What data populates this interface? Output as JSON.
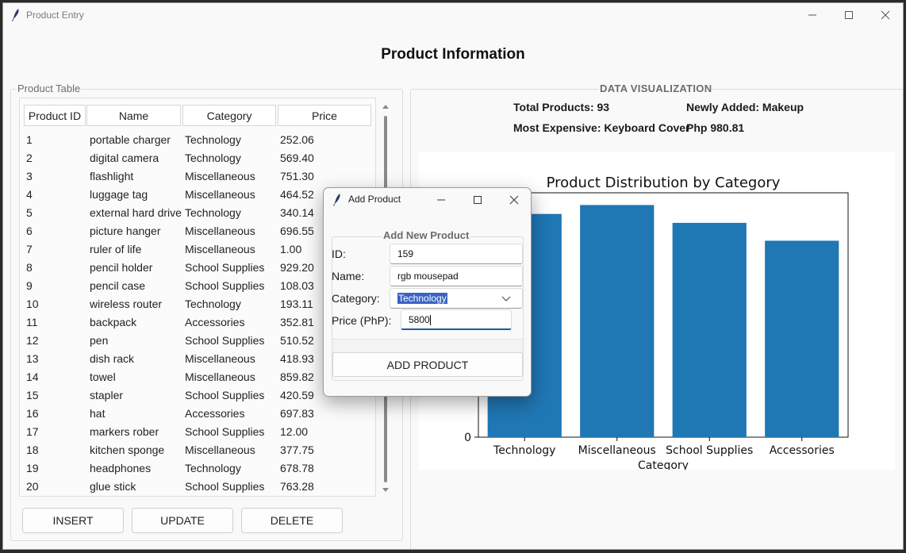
{
  "window": {
    "title": "Product Entry"
  },
  "heading": "Product Information",
  "table_frame_label": "Product Table",
  "columns": [
    "Product ID",
    "Name",
    "Category",
    "Price"
  ],
  "rows": [
    [
      "1",
      "portable charger",
      "Technology",
      "252.06"
    ],
    [
      "2",
      "digital camera",
      "Technology",
      "569.40"
    ],
    [
      "3",
      "flashlight",
      "Miscellaneous",
      "751.30"
    ],
    [
      "4",
      "luggage tag",
      "Miscellaneous",
      "464.52"
    ],
    [
      "5",
      "external hard drive",
      "Technology",
      "340.14"
    ],
    [
      "6",
      "picture hanger",
      "Miscellaneous",
      "696.55"
    ],
    [
      "7",
      "ruler of life",
      "Miscellaneous",
      "1.00"
    ],
    [
      "8",
      "pencil holder",
      "School Supplies",
      "929.20"
    ],
    [
      "9",
      "pencil case",
      "School Supplies",
      "108.03"
    ],
    [
      "10",
      "wireless router",
      "Technology",
      "193.11"
    ],
    [
      "11",
      "backpack",
      "Accessories",
      "352.81"
    ],
    [
      "12",
      "pen",
      "School Supplies",
      "510.52"
    ],
    [
      "13",
      "dish rack",
      "Miscellaneous",
      "418.93"
    ],
    [
      "14",
      "towel",
      "Miscellaneous",
      "859.82"
    ],
    [
      "15",
      "stapler",
      "School Supplies",
      "420.59"
    ],
    [
      "16",
      "hat",
      "Accessories",
      "697.83"
    ],
    [
      "17",
      "markers rober",
      "School Supplies",
      "12.00"
    ],
    [
      "18",
      "kitchen sponge",
      "Miscellaneous",
      "377.75"
    ],
    [
      "19",
      "headphones",
      "Technology",
      "678.78"
    ],
    [
      "20",
      "glue stick",
      "School Supplies",
      "763.28"
    ]
  ],
  "buttons": {
    "insert": "INSERT",
    "update": "UPDATE",
    "delete": "DELETE"
  },
  "viz": {
    "label": "DATA VISUALIZATION",
    "total_products": "Total Products: 93",
    "newly_added": "Newly Added: Makeup",
    "most_expensive": "Most Expensive: Keyboard Cover",
    "most_expensive_price": "Php 980.81"
  },
  "chart_data": {
    "type": "bar",
    "title": "Product Distribution by Category",
    "xlabel": "Category",
    "ylabel": "",
    "categories": [
      "Technology",
      "Miscellaneous",
      "School Supplies",
      "Accessories"
    ],
    "values": [
      25,
      26,
      24,
      22
    ],
    "visible_ytick": "0",
    "color": "#1f77b4",
    "note_partially_hidden": true
  },
  "dialog": {
    "title": "Add Product",
    "group_label": "Add New Product",
    "id_label": "ID:",
    "id_value": "159",
    "name_label": "Name:",
    "name_value": "rgb mousepad",
    "category_label": "Category:",
    "category_value": "Technology",
    "price_label": "Price (PhP):",
    "price_value": "5800",
    "submit": "ADD PRODUCT"
  },
  "colors": {
    "bar": "#1f77b4",
    "selection": "#3a63c4",
    "focus": "#1e5aa8"
  }
}
